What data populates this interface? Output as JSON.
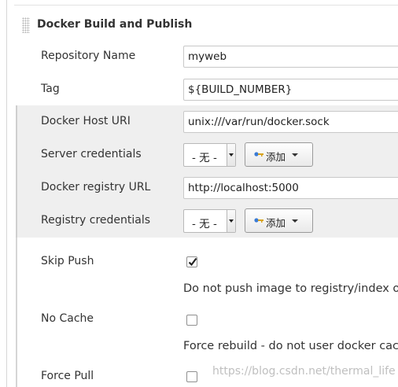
{
  "section": {
    "title": "Docker Build and Publish"
  },
  "fields": {
    "repository_name": {
      "label": "Repository Name",
      "value": "myweb"
    },
    "tag": {
      "label": "Tag",
      "value": "${BUILD_NUMBER}"
    },
    "docker_host_uri": {
      "label": "Docker Host URI",
      "value": "unix:///var/run/docker.sock"
    },
    "server_credentials": {
      "label": "Server credentials",
      "selected": "- 无 -",
      "add_label": "添加"
    },
    "docker_registry_url": {
      "label": "Docker registry URL",
      "value": "http://localhost:5000"
    },
    "registry_credentials": {
      "label": "Registry credentials",
      "selected": "- 无 -",
      "add_label": "添加"
    },
    "skip_push": {
      "label": "Skip Push",
      "checked": true,
      "description": "Do not push image to registry/index on"
    },
    "no_cache": {
      "label": "No Cache",
      "checked": false,
      "description": "Force rebuild - do not user docker cach"
    },
    "force_pull": {
      "label": "Force Pull",
      "checked": false
    }
  },
  "icons": {
    "drag_handle": "drag-handle-icon",
    "key": "key-icon",
    "dropdown_caret": "caret-down-icon",
    "checkmark": "checkmark-icon"
  },
  "colors": {
    "shaded_background": "#efefef",
    "key_icon_blue": "#3a7bd5",
    "key_icon_gold": "#d8a21c"
  },
  "watermark": "https://blog.csdn.net/thermal_life"
}
